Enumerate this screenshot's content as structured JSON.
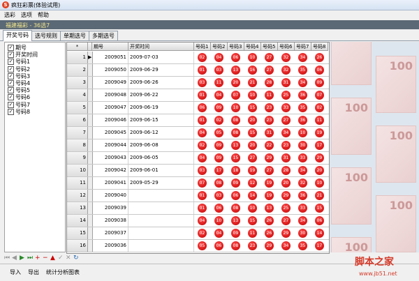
{
  "window": {
    "title": "疯狂彩票(体验试用)",
    "icon": "S"
  },
  "menu": [
    "选彩",
    "选项",
    "帮助"
  ],
  "info": {
    "text": "福建福彩 - 36选7"
  },
  "tabs": [
    "开奖号码",
    "选号规则",
    "单期选号",
    "多期选号"
  ],
  "fields": [
    "期号",
    "开奖时间",
    "号码1",
    "号码2",
    "号码3",
    "号码4",
    "号码5",
    "号码6",
    "号码7",
    "号码8"
  ],
  "table": {
    "headers": {
      "rownum": "*",
      "period": "期号",
      "date": "开奖时间",
      "balls": [
        "号码1",
        "号码2",
        "号码3",
        "号码4",
        "号码5",
        "号码6",
        "号码7",
        "号码8"
      ]
    },
    "rows": [
      {
        "n": "1",
        "period": "2009051",
        "date": "2009-07-03",
        "balls": [
          "02",
          "04",
          "06",
          "10",
          "27",
          "32",
          "34",
          "26"
        ]
      },
      {
        "n": "2",
        "period": "2009050",
        "date": "2009-06-29",
        "balls": [
          "01",
          "03",
          "13",
          "16",
          "27",
          "32",
          "35",
          "06"
        ]
      },
      {
        "n": "3",
        "period": "2009049",
        "date": "2009-06-26",
        "balls": [
          "03",
          "11",
          "20",
          "21",
          "28",
          "31",
          "34",
          "09"
        ]
      },
      {
        "n": "4",
        "period": "2009048",
        "date": "2009-06-22",
        "balls": [
          "01",
          "04",
          "07",
          "10",
          "11",
          "25",
          "36",
          "07"
        ]
      },
      {
        "n": "5",
        "period": "2009047",
        "date": "2009-06-19",
        "balls": [
          "06",
          "09",
          "10",
          "15",
          "23",
          "33",
          "35",
          "02"
        ]
      },
      {
        "n": "6",
        "period": "2009046",
        "date": "2009-06-15",
        "balls": [
          "01",
          "02",
          "08",
          "20",
          "23",
          "27",
          "36",
          "11"
        ]
      },
      {
        "n": "7",
        "period": "2009045",
        "date": "2009-06-12",
        "balls": [
          "04",
          "05",
          "08",
          "15",
          "31",
          "34",
          "10",
          "19"
        ]
      },
      {
        "n": "8",
        "period": "2009044",
        "date": "2009-06-08",
        "balls": [
          "02",
          "09",
          "13",
          "20",
          "22",
          "23",
          "30",
          "17"
        ]
      },
      {
        "n": "9",
        "period": "2009043",
        "date": "2009-06-05",
        "balls": [
          "04",
          "09",
          "15",
          "27",
          "29",
          "31",
          "33",
          "29"
        ]
      },
      {
        "n": "10",
        "period": "2009042",
        "date": "2009-06-01",
        "balls": [
          "03",
          "17",
          "18",
          "19",
          "27",
          "28",
          "34",
          "20"
        ]
      },
      {
        "n": "11",
        "period": "2009041",
        "date": "2009-05-29",
        "balls": [
          "07",
          "08",
          "09",
          "12",
          "19",
          "20",
          "32",
          "10"
        ]
      },
      {
        "n": "12",
        "period": "2009040",
        "date": "",
        "balls": [
          "01",
          "03",
          "06",
          "14",
          "19",
          "29",
          "36",
          "21"
        ]
      },
      {
        "n": "13",
        "period": "2009039",
        "date": "",
        "balls": [
          "01",
          "06",
          "08",
          "10",
          "13",
          "25",
          "33",
          "15"
        ]
      },
      {
        "n": "14",
        "period": "2009038",
        "date": "",
        "balls": [
          "04",
          "10",
          "13",
          "15",
          "26",
          "27",
          "34",
          "06"
        ]
      },
      {
        "n": "15",
        "period": "2009037",
        "date": "",
        "balls": [
          "02",
          "04",
          "09",
          "11",
          "26",
          "29",
          "30",
          "14"
        ]
      },
      {
        "n": "16",
        "period": "2009036",
        "date": "",
        "balls": [
          "05",
          "06",
          "08",
          "23",
          "29",
          "34",
          "35",
          "17"
        ]
      }
    ]
  },
  "navigator": [
    "⏮",
    "◀",
    "▶",
    "⏭",
    "+",
    "−",
    "▲",
    "✓",
    "✕",
    "↻"
  ],
  "bottom_buttons": [
    "导入",
    "导出",
    "统计分析图表"
  ],
  "watermark": {
    "text": "脚本之家",
    "url": "www.jb51.net"
  },
  "background_note_value": "100",
  "colors": {
    "ball": "#d00000",
    "infobar": "#5b6875",
    "info_text": "#f0e68c"
  }
}
